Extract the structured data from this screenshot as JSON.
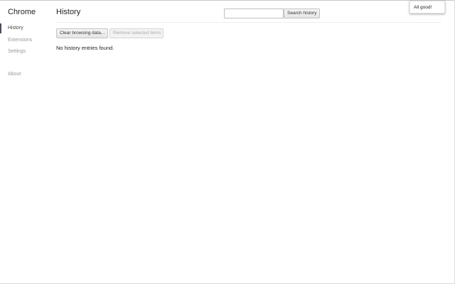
{
  "sidebar": {
    "brand": "Chrome",
    "items": [
      {
        "label": "History",
        "active": true
      },
      {
        "label": "Extensions",
        "active": false
      },
      {
        "label": "Settings",
        "active": false
      },
      {
        "label": "About",
        "active": false
      }
    ]
  },
  "header": {
    "title": "History",
    "search": {
      "value": "",
      "placeholder": "",
      "button_label": "Search history"
    }
  },
  "toolbar": {
    "clear_label": "Clear browsing data...",
    "remove_label": "Remove selected items"
  },
  "main": {
    "empty_message": "No history entries found."
  },
  "popup": {
    "message": "All good!"
  },
  "colors": {
    "active_indicator": "#464e5a",
    "nav_inactive_text": "#999999",
    "border": "#c3c3c3"
  }
}
